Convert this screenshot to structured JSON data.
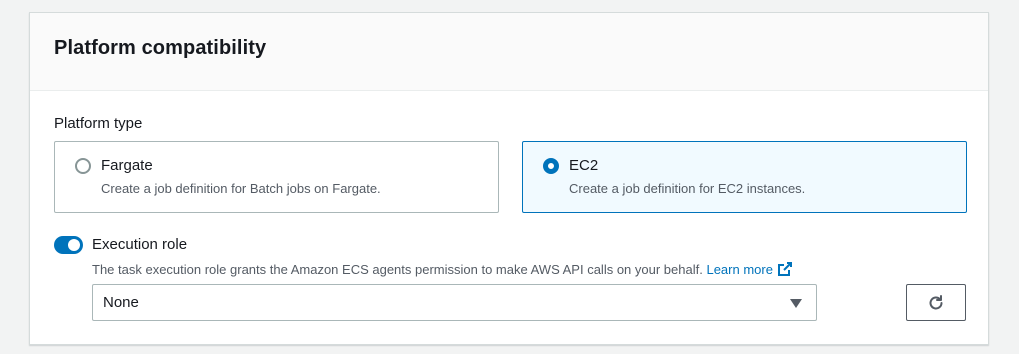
{
  "panel": {
    "title": "Platform compatibility"
  },
  "platform_type": {
    "label": "Platform type",
    "options": [
      {
        "title": "Fargate",
        "description": "Create a job definition for Batch jobs on Fargate.",
        "selected": false
      },
      {
        "title": "EC2",
        "description": "Create a job definition for EC2 instances.",
        "selected": true
      }
    ]
  },
  "execution_role": {
    "label": "Execution role",
    "enabled": true,
    "description": "The task execution role grants the Amazon ECS agents permission to make AWS API calls on your behalf.",
    "learn_more": "Learn more",
    "selected_value": "None"
  },
  "colors": {
    "accent": "#0073bb",
    "selected_tile_bg": "#f1faff",
    "text": "#16191f",
    "secondary_text": "#545b64"
  },
  "icons": {
    "external_link": "external-link-icon",
    "dropdown_caret": "caret-down-icon",
    "refresh": "refresh-icon"
  }
}
